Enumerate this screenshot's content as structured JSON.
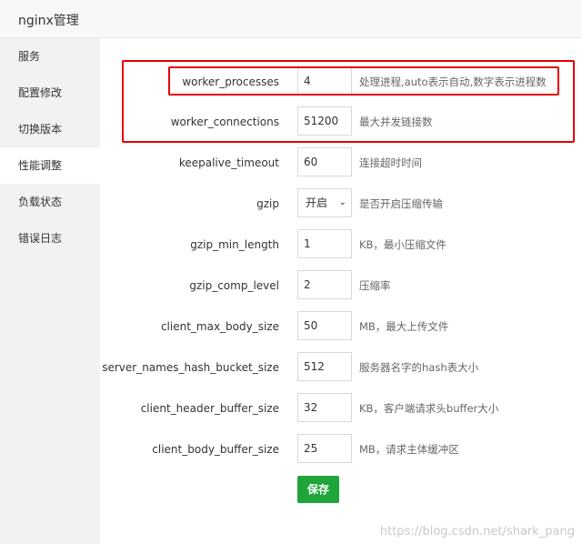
{
  "window": {
    "title": "nginx管理"
  },
  "sidebar": {
    "items": [
      {
        "label": "服务"
      },
      {
        "label": "配置修改"
      },
      {
        "label": "切换版本"
      },
      {
        "label": "性能调整"
      },
      {
        "label": "负载状态"
      },
      {
        "label": "错误日志"
      }
    ],
    "active": "性能调整"
  },
  "form": {
    "rows": [
      {
        "label": "worker_processes",
        "value": "4",
        "desc": "处理进程,auto表示自动,数字表示进程数"
      },
      {
        "label": "worker_connections",
        "value": "51200",
        "desc": "最大并发链接数"
      },
      {
        "label": "keepalive_timeout",
        "value": "60",
        "desc": "连接超时时间"
      },
      {
        "label": "gzip",
        "value": "开启",
        "desc": "是否开启压缩传输"
      },
      {
        "label": "gzip_min_length",
        "value": "1",
        "desc": "KB，最小压缩文件"
      },
      {
        "label": "gzip_comp_level",
        "value": "2",
        "desc": "压缩率"
      },
      {
        "label": "client_max_body_size",
        "value": "50",
        "desc": "MB，最大上传文件"
      },
      {
        "label": "server_names_hash_bucket_size",
        "value": "512",
        "desc": "服务器名字的hash表大小"
      },
      {
        "label": "client_header_buffer_size",
        "value": "32",
        "desc": "KB，客户端请求头buffer大小"
      },
      {
        "label": "client_body_buffer_size",
        "value": "25",
        "desc": "MB，请求主体缓冲区"
      }
    ],
    "save_label": "保存"
  },
  "watermark": "https://blog.csdn.net/shark_pang",
  "colors": {
    "accent": "#20a53a",
    "highlight": "#e60000",
    "sidebar_bg": "#f2f2f2"
  }
}
